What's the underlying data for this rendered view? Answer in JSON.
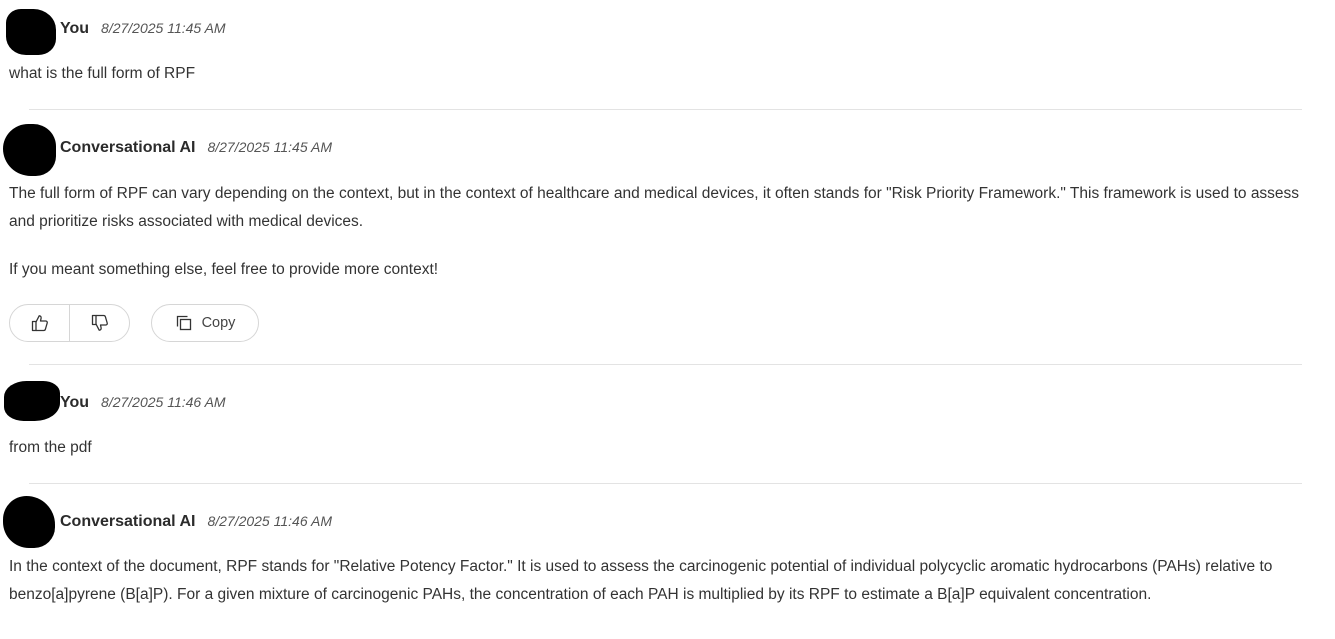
{
  "messages": [
    {
      "author": "You",
      "timestamp": "8/27/2025 11:45 AM",
      "paragraphs": [
        "what is the full form of RPF"
      ]
    },
    {
      "author": "Conversational AI",
      "timestamp": "8/27/2025 11:45 AM",
      "paragraphs": [
        "The full form of RPF can vary depending on the context, but in the context of healthcare and medical devices, it often stands for \"Risk Priority Framework.\" This framework is used to assess and prioritize risks associated with medical devices.",
        "If you meant something else, feel free to provide more context!"
      ],
      "actions": {
        "thumbs_up_icon": "thumbs-up-icon",
        "thumbs_down_icon": "thumbs-down-icon",
        "copy_icon": "copy-icon",
        "copy_label": "Copy"
      }
    },
    {
      "author": "You",
      "timestamp": "8/27/2025 11:46 AM",
      "paragraphs": [
        "from the pdf"
      ]
    },
    {
      "author": "Conversational AI",
      "timestamp": "8/27/2025 11:46 AM",
      "paragraphs": [
        "In the context of the document, RPF stands for \"Relative Potency Factor.\" It is used to assess the carcinogenic potential of individual polycyclic aromatic hydrocarbons (PAHs) relative to benzo[a]pyrene (B[a]P). For a given mixture of carcinogenic PAHs, the concentration of each PAH is multiplied by its RPF to estimate a B[a]P equivalent concentration."
      ]
    }
  ]
}
